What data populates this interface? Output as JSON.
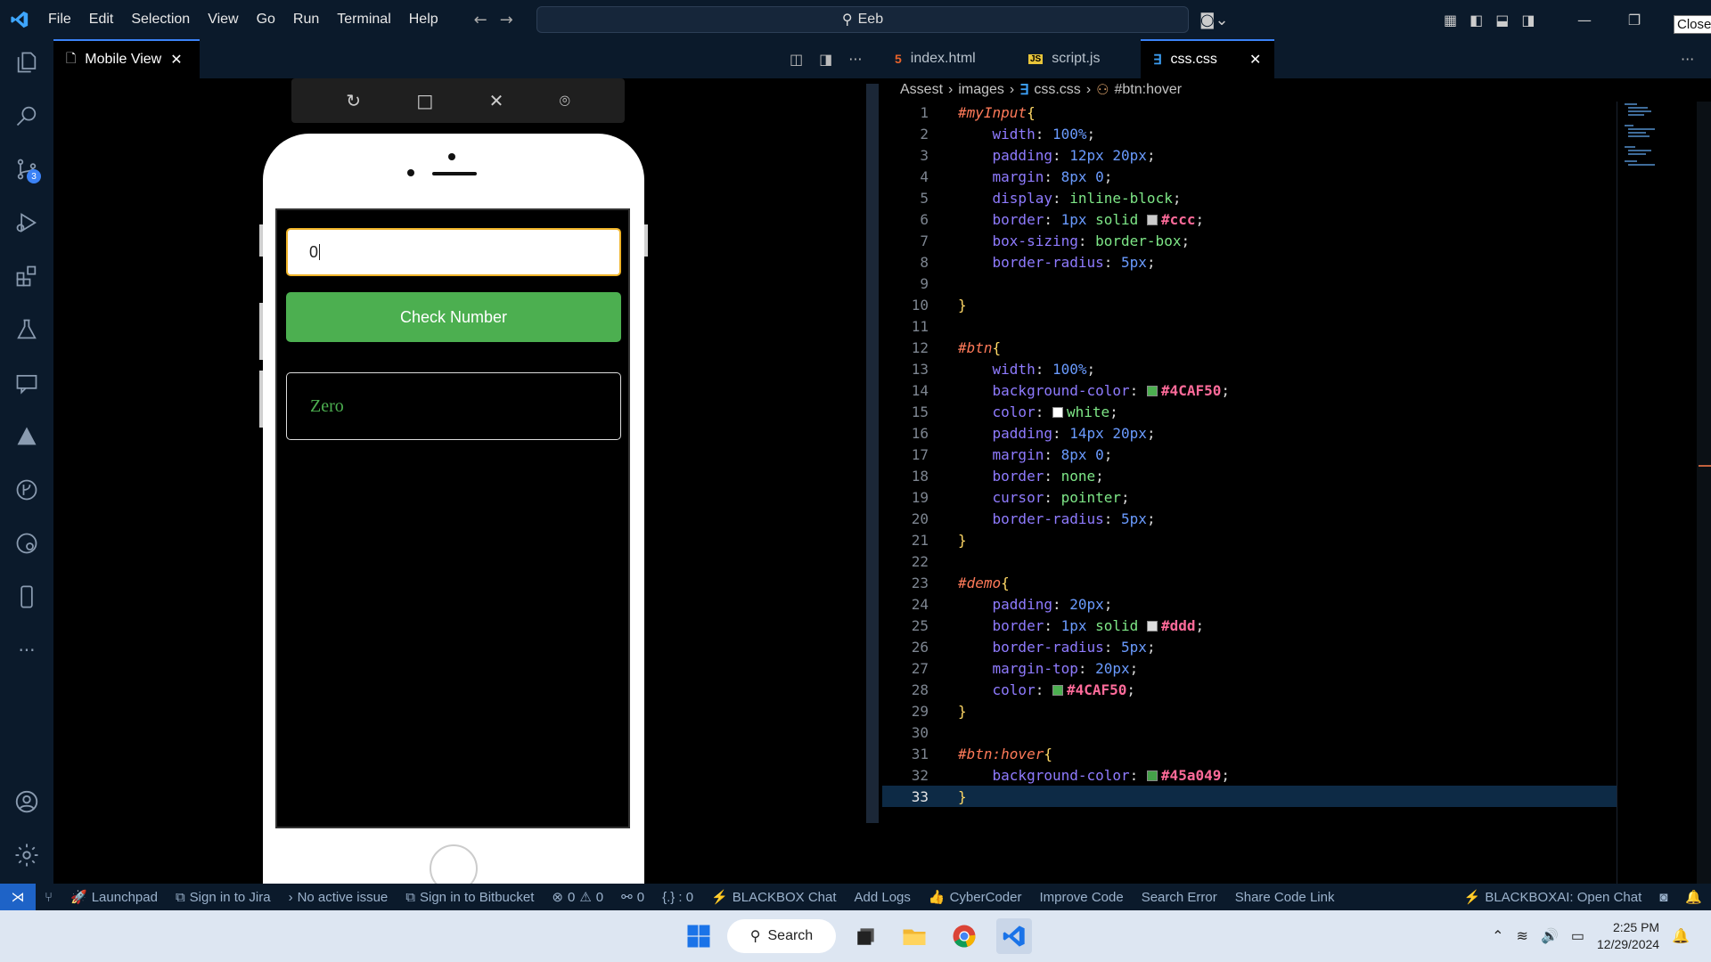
{
  "titlebar": {
    "menu": [
      "File",
      "Edit",
      "Selection",
      "View",
      "Go",
      "Run",
      "Terminal",
      "Help"
    ],
    "search_text": "Eeb",
    "close_tooltip": "Close"
  },
  "activitybar": {
    "source_control_badge": "3"
  },
  "left_editor": {
    "tab_label": "Mobile View"
  },
  "mobile_app": {
    "input_value": "0",
    "button_label": "Check Number",
    "result_text": "Zero"
  },
  "right_editor": {
    "tabs": [
      "index.html",
      "script.js",
      "css.css"
    ],
    "breadcrumb": [
      "Assest",
      "images",
      "css.css",
      "#btn:hover"
    ]
  },
  "code": {
    "line_numbers": [
      "1",
      "2",
      "3",
      "4",
      "5",
      "6",
      "7",
      "8",
      "9",
      "10",
      "11",
      "12",
      "13",
      "14",
      "15",
      "16",
      "17",
      "18",
      "19",
      "20",
      "21",
      "22",
      "23",
      "24",
      "25",
      "26",
      "27",
      "28",
      "29",
      "30",
      "31",
      "32",
      "33"
    ],
    "current_line": 33,
    "swatch_colors": {
      "ccc": "#cccccc",
      "green": "#4CAF50",
      "white": "#ffffff",
      "ddd": "#dddddd",
      "hover": "#45a049"
    }
  },
  "statusbar": {
    "items": [
      "Launchpad",
      "Sign in to Jira",
      "No active issue",
      "Sign in to Bitbucket",
      "0",
      "0",
      "0",
      "{.} : 0",
      "BLACKBOX Chat",
      "Add Logs",
      "CyberCoder",
      "Improve Code",
      "Search Error",
      "Share Code Link"
    ],
    "right_item": "BLACKBOXAI: Open Chat"
  },
  "taskbar": {
    "search_label": "Search",
    "time": "2:25 PM",
    "date": "12/29/2024"
  }
}
